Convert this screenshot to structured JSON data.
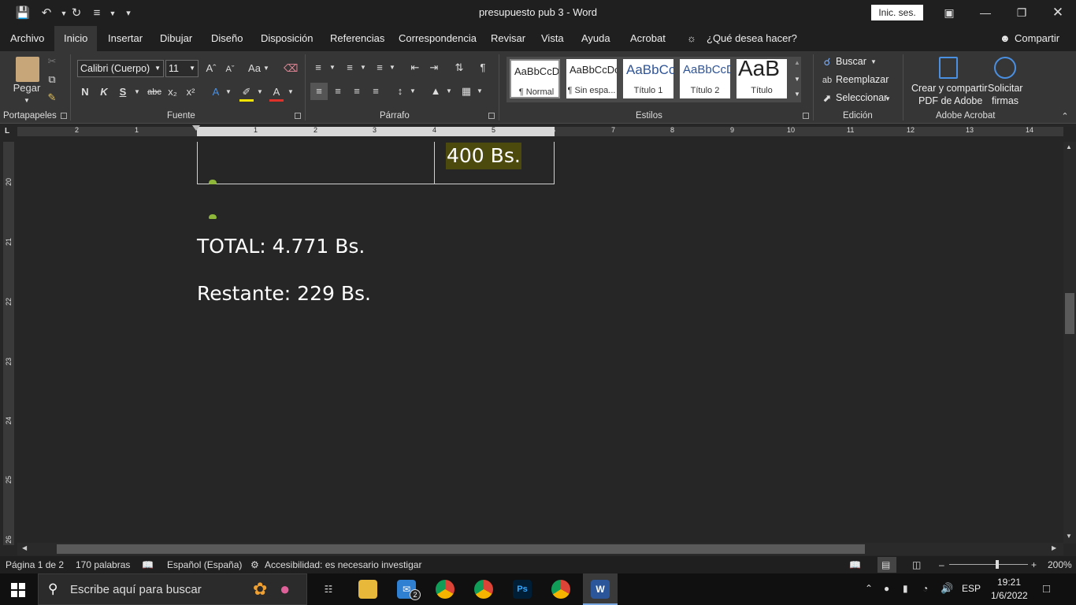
{
  "window": {
    "doc_title": "presupuesto pub 3  -  Word",
    "signin_label": "Inic. ses."
  },
  "menu": {
    "tabs": [
      "Archivo",
      "Inicio",
      "Insertar",
      "Dibujar",
      "Diseño",
      "Disposición",
      "Referencias",
      "Correspondencia",
      "Revisar",
      "Vista",
      "Ayuda",
      "Acrobat"
    ],
    "tell_me": "¿Qué desea hacer?",
    "share": "Compartir"
  },
  "ribbon": {
    "clipboard": {
      "paste": "Pegar",
      "group": "Portapapeles"
    },
    "font": {
      "name": "Calibri (Cuerpo)",
      "size": "11",
      "case": "Aa",
      "group": "Fuente"
    },
    "paragraph": {
      "group": "Párrafo"
    },
    "styles": {
      "group": "Estilos",
      "items": [
        {
          "sample": "AaBbCcDc",
          "name": "¶ Normal"
        },
        {
          "sample": "AaBbCcDc",
          "name": "¶ Sin espa..."
        },
        {
          "sample": "AaBbCc",
          "name": "Título 1"
        },
        {
          "sample": "AaBbCcD",
          "name": "Título 2"
        },
        {
          "sample": "AaB",
          "name": "Título"
        }
      ]
    },
    "editing": {
      "find": "Buscar",
      "replace": "Reemplazar",
      "select": "Seleccionar",
      "group": "Edición"
    },
    "acrobat": {
      "create": "Crear y compartir",
      "create2": "PDF de Adobe",
      "sign": "Solicitar",
      "sign2": "firmas",
      "group": "Adobe Acrobat"
    }
  },
  "ruler": {
    "h_labels": [
      "2",
      "1",
      "1",
      "2",
      "3",
      "4",
      "5",
      "6",
      "7",
      "8",
      "9",
      "10",
      "11",
      "12",
      "13",
      "14"
    ],
    "v_labels": [
      "20",
      "21",
      "22",
      "23",
      "24",
      "25",
      "26"
    ]
  },
  "document": {
    "cell_value": "400 Bs.",
    "total": "TOTAL: 4.771 Bs.",
    "remaining": "Restante: 229 Bs."
  },
  "status": {
    "page": "Página 1 de 2",
    "words": "170 palabras",
    "language": "Español (España)",
    "accessibility": "Accesibilidad: es necesario investigar",
    "zoom": "200%"
  },
  "taskbar": {
    "search_placeholder": "Escribe aquí para buscar",
    "lang": "ESP",
    "time": "19:21",
    "date": "1/6/2022",
    "mail_badge": "2"
  },
  "colors": {
    "highlight": "#4d4a0e",
    "marker": "#8fb83a"
  }
}
